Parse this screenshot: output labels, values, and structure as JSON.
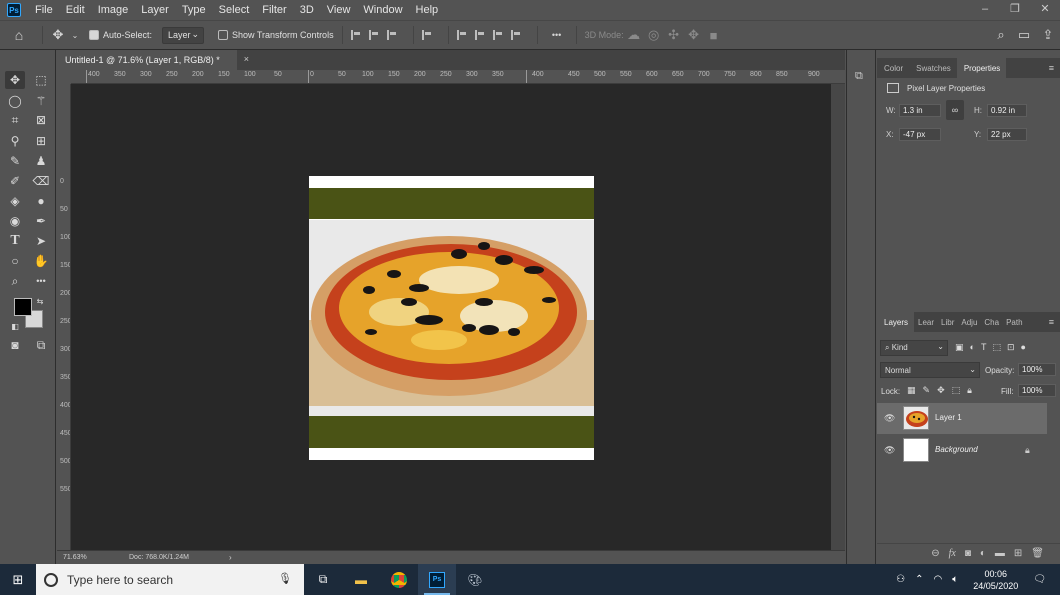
{
  "menubar": {
    "logo": "Ps",
    "items": [
      "File",
      "Edit",
      "Image",
      "Layer",
      "Type",
      "Select",
      "Filter",
      "3D",
      "View",
      "Window",
      "Help"
    ],
    "window_controls": [
      "–",
      "❐",
      "✕"
    ]
  },
  "options": {
    "auto_select_label": "Auto-Select:",
    "auto_select_checked": true,
    "target_value": "Layer",
    "show_transform_label": "Show Transform Controls",
    "show_transform_checked": false,
    "more_label": "•••",
    "mode_3d_label": "3D Mode:"
  },
  "document": {
    "tab_title": "Untitled-1 @ 71.6% (Layer 1, RGB/8) *",
    "close_label": "×",
    "zoom": "71.63%",
    "doc_info": "Doc: 768.0K/1.24M",
    "ruler_labels": [
      "400",
      "350",
      "300",
      "250",
      "200",
      "150",
      "100",
      "50",
      "0",
      "50",
      "100",
      "150",
      "200",
      "250",
      "300",
      "350",
      "400",
      "450",
      "500",
      "550",
      "600",
      "650",
      "700",
      "750",
      "800",
      "850",
      "900"
    ]
  },
  "properties_panel": {
    "tabs": [
      "Color",
      "Swatches",
      "Properties"
    ],
    "active_tab": "Properties",
    "header": "Pixel Layer Properties",
    "w_label": "W:",
    "w_value": "1.3 in",
    "h_label": "H:",
    "h_value": "0.92 in",
    "x_label": "X:",
    "x_value": "-47 px",
    "y_label": "Y:",
    "y_value": "22 px"
  },
  "layers_panel": {
    "tabs": [
      "Layers",
      "Lear",
      "Libr",
      "Adju",
      "Cha",
      "Path"
    ],
    "active_tab": "Layers",
    "filter_label": "Kind",
    "blend_mode": "Normal",
    "opacity_label": "Opacity:",
    "opacity_value": "100%",
    "lock_label": "Lock:",
    "fill_label": "Fill:",
    "fill_value": "100%",
    "layers": [
      {
        "name": "Layer 1",
        "selected": true
      },
      {
        "name": "Background",
        "selected": false,
        "locked": true
      }
    ]
  },
  "taskbar": {
    "search_placeholder": "Type here to search",
    "time": "00:06",
    "date": "24/05/2020"
  },
  "colors": {
    "band": "#4a5315",
    "canvas_bg": "#282828",
    "ui_bg": "#535353",
    "taskbar": "#1c2a3a"
  }
}
